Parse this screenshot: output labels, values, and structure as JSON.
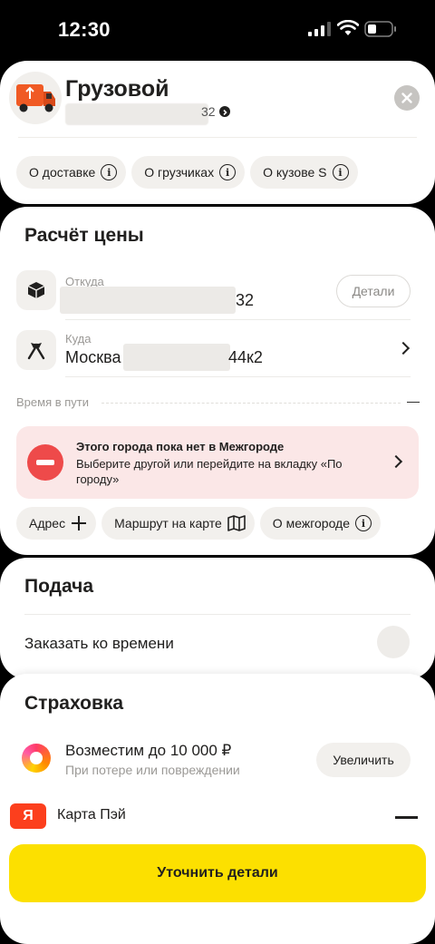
{
  "status_bar": {
    "time": "12:30"
  },
  "tariff": {
    "title": "Грузовой",
    "address_suffix": "32",
    "chips": [
      {
        "label": "О доставке",
        "icon": "info-icon"
      },
      {
        "label": "О грузчиках",
        "icon": "info-icon"
      },
      {
        "label": "О кузове S",
        "icon": "info-icon"
      }
    ]
  },
  "price": {
    "title": "Расчёт цены",
    "from": {
      "label": "Откуда",
      "value_suffix": "32",
      "details_label": "Детали"
    },
    "to": {
      "label": "Куда",
      "value_prefix": "Москва",
      "value_suffix": "44к2"
    },
    "travel_time": {
      "label": "Время в пути",
      "value": "—"
    },
    "alert": {
      "title": "Этого города пока нет в Межгороде",
      "text": "Выберите другой или перейдите на вкладку «По городу»"
    },
    "chips": [
      {
        "label": "Адрес",
        "icon": "plus-icon"
      },
      {
        "label": "Маршрут на карте",
        "icon": "map-icon"
      },
      {
        "label": "О межгороде",
        "icon": "info-icon"
      }
    ]
  },
  "pickup": {
    "title": "Подача",
    "schedule_label": "Заказать ко времени"
  },
  "insurance": {
    "title": "Страховка",
    "coverage": "Возместим до 10 000 ₽",
    "coverage_sub": "При потере или повреждении",
    "increase_label": "Увеличить"
  },
  "payment": {
    "badge": "Я",
    "label": "Карта Пэй"
  },
  "cta": {
    "label": "Уточнить детали"
  },
  "colors": {
    "accent": "#fce000",
    "alert_bg": "#fbe7e7",
    "alert_icon": "#ee4a4a",
    "pay_brand": "#fc3f1d"
  }
}
